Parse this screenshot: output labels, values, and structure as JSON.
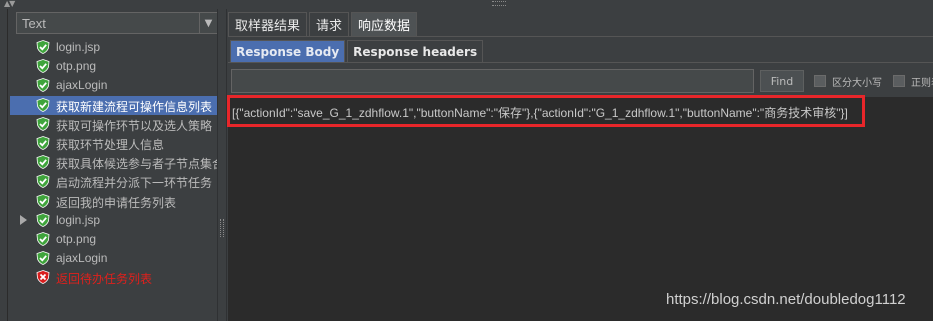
{
  "combo": {
    "value": "Text"
  },
  "tree": [
    {
      "label": "login.jsp",
      "status": "ok",
      "expandable": false,
      "selected": false
    },
    {
      "label": "otp.png",
      "status": "ok",
      "expandable": false,
      "selected": false
    },
    {
      "label": "ajaxLogin",
      "status": "ok",
      "expandable": false,
      "selected": false
    },
    {
      "label": "获取新建流程可操作信息列表",
      "status": "ok",
      "expandable": false,
      "selected": true
    },
    {
      "label": "获取可操作环节以及选人策略",
      "status": "ok",
      "expandable": false,
      "selected": false
    },
    {
      "label": "获取环节处理人信息",
      "status": "ok",
      "expandable": false,
      "selected": false
    },
    {
      "label": "获取具体候选参与者子节点集合",
      "status": "ok",
      "expandable": false,
      "selected": false
    },
    {
      "label": "启动流程并分派下一环节任务",
      "status": "ok",
      "expandable": false,
      "selected": false
    },
    {
      "label": "返回我的申请任务列表",
      "status": "ok",
      "expandable": false,
      "selected": false
    },
    {
      "label": "login.jsp",
      "status": "ok",
      "expandable": true,
      "selected": false
    },
    {
      "label": "otp.png",
      "status": "ok",
      "expandable": false,
      "selected": false
    },
    {
      "label": "ajaxLogin",
      "status": "ok",
      "expandable": false,
      "selected": false
    },
    {
      "label": "返回待办任务列表",
      "status": "error",
      "expandable": false,
      "selected": false
    }
  ],
  "outer_tabs": [
    {
      "label": "取样器结果",
      "active": false
    },
    {
      "label": "请求",
      "active": false
    },
    {
      "label": "响应数据",
      "active": true
    }
  ],
  "inner_tabs": [
    {
      "label": "Response Body",
      "active": true
    },
    {
      "label": "Response headers",
      "active": false
    }
  ],
  "search": {
    "value": "",
    "placeholder": ""
  },
  "find_label": "Find",
  "case_sensitive_label": "区分大小写",
  "regex_label": "正则表",
  "response_body": "[{\"actionId\":\"save_G_1_zdhflow.1\",\"buttonName\":\"保存\"},{\"actionId\":\"G_1_zdhflow.1\",\"buttonName\":\"商务技术审核\"}]",
  "watermark": "https://blog.csdn.net/doubledog1112",
  "colors": {
    "selection": "#4b6eaf",
    "ok_icon": "#3fa43c",
    "error_icon": "#d81e1e",
    "highlight_box": "#e8262a"
  }
}
